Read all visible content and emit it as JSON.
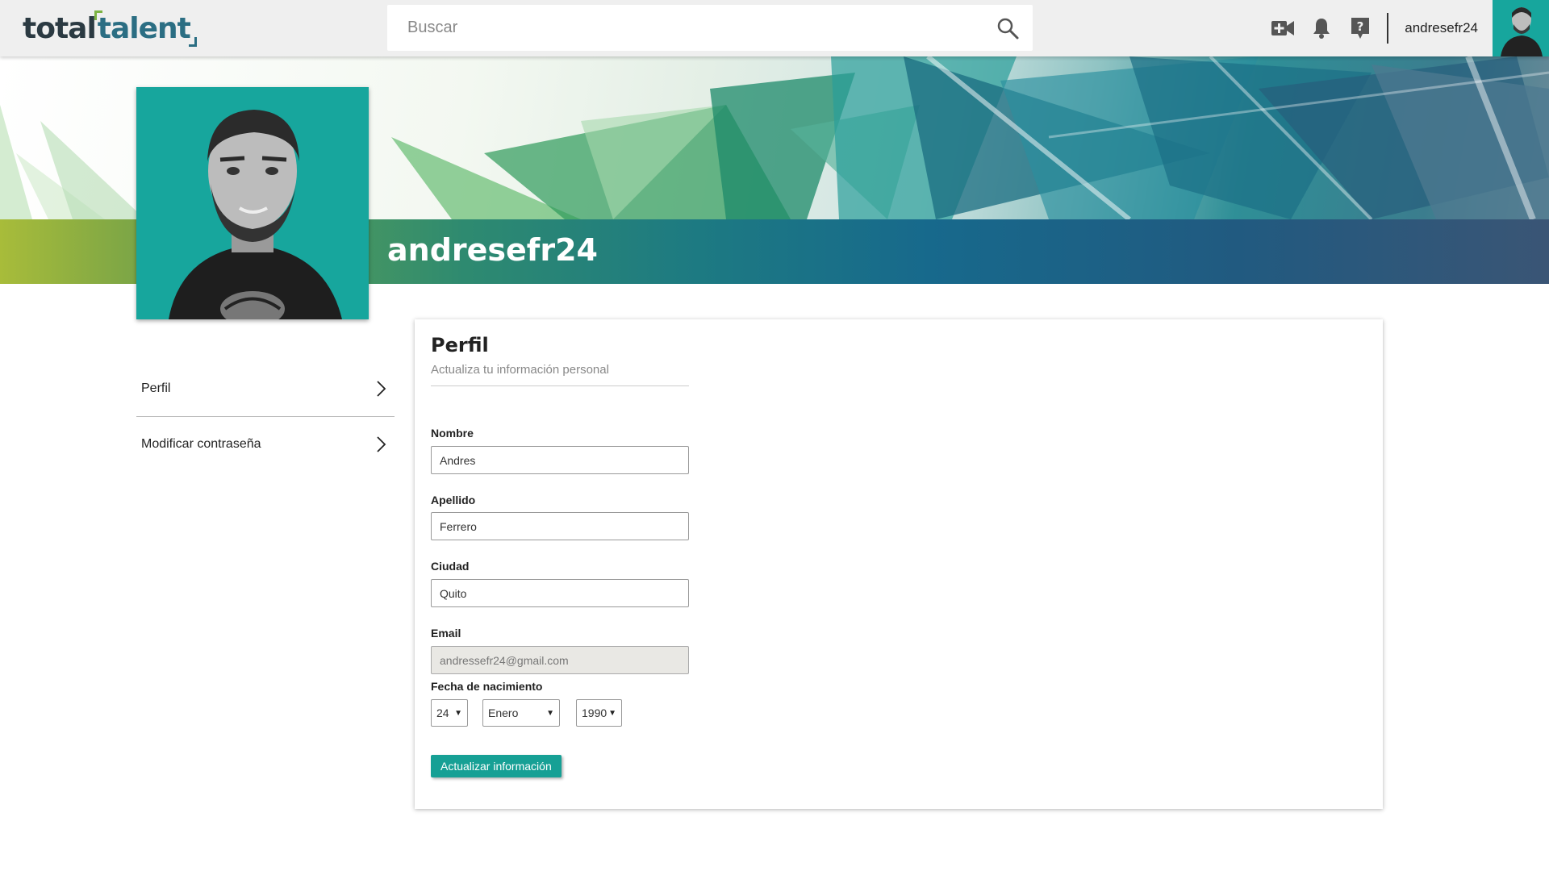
{
  "header": {
    "logo_total": "total",
    "logo_talent": "talent",
    "search_placeholder": "Buscar",
    "username": "andresefr24"
  },
  "profile": {
    "name": "andresefr24"
  },
  "sidemenu": {
    "items": [
      {
        "label": "Perfil"
      },
      {
        "label": "Modificar contraseña"
      }
    ]
  },
  "form": {
    "title": "Perfil",
    "subtitle": "Actualiza tu información personal",
    "fields": {
      "nombre": {
        "label": "Nombre",
        "value": "Andres"
      },
      "apellido": {
        "label": "Apellido",
        "value": "Ferrero"
      },
      "ciudad": {
        "label": "Ciudad",
        "value": "Quito"
      },
      "email": {
        "label": "Email",
        "value": "andressefr24@gmail.com"
      }
    },
    "birthdate": {
      "label": "Fecha de nacimiento",
      "day": "24",
      "month": "Enero",
      "year": "1990"
    },
    "submit_label": "Actualizar información"
  },
  "colors": {
    "accent": "#16a095",
    "avatar_bg": "#17a69d",
    "topbar_bg": "#efefef"
  },
  "icons": [
    "search-icon",
    "video-add-icon",
    "bell-icon",
    "help-icon",
    "chevron-right-icon",
    "dropdown-arrow-icon"
  ]
}
